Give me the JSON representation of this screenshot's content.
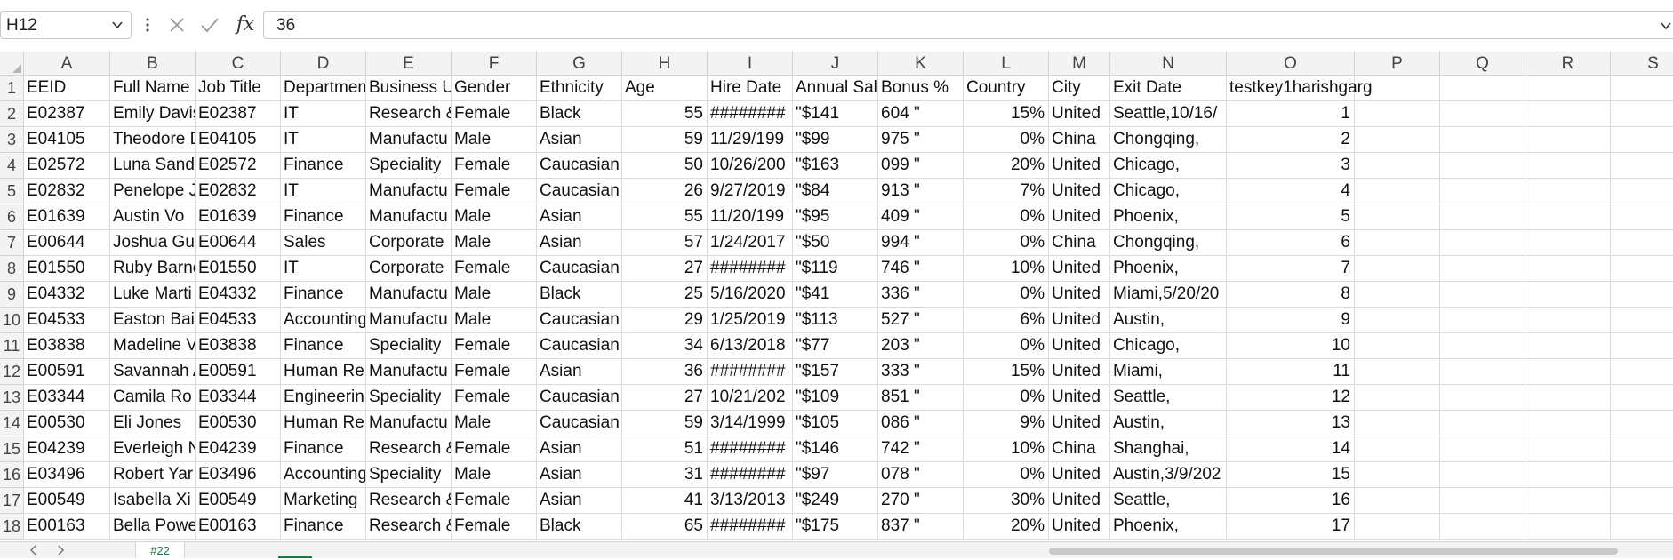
{
  "formula_bar": {
    "name_box": "H12",
    "cancel_icon": "x-icon",
    "enter_icon": "check-icon",
    "fx_label": "fx",
    "formula_value": "36"
  },
  "columns": [
    "A",
    "B",
    "C",
    "D",
    "E",
    "F",
    "G",
    "H",
    "I",
    "J",
    "K",
    "L",
    "M",
    "N",
    "O",
    "P",
    "Q",
    "R",
    "S"
  ],
  "rows": [
    {
      "n": "1",
      "cells": [
        "EEID",
        "Full Name",
        "Job Title",
        "Departmen",
        "Business U",
        "Gender",
        "Ethnicity",
        "Age",
        "Hire Date",
        "Annual Sal",
        "Bonus %",
        "Country",
        "City",
        "Exit Date",
        "testkey1harishgarg",
        "",
        "",
        "",
        ""
      ]
    },
    {
      "n": "2",
      "cells": [
        "E02387",
        "Emily Davis",
        "E02387",
        "IT",
        "Research &",
        "Female",
        "Black",
        "55",
        "########",
        "\"$141",
        "604 \"",
        "15%",
        "United",
        "Seattle,10/16/",
        "1",
        "",
        "",
        "",
        ""
      ]
    },
    {
      "n": "3",
      "cells": [
        "E04105",
        "Theodore D",
        "E04105",
        "IT",
        "Manufactu",
        "Male",
        "Asian",
        "59",
        "11/29/199",
        "\"$99",
        "975 \"",
        "0%",
        "China",
        "Chongqing,",
        "2",
        "",
        "",
        "",
        ""
      ]
    },
    {
      "n": "4",
      "cells": [
        "E02572",
        "Luna Sand",
        "E02572",
        "Finance",
        "Speciality",
        "Female",
        "Caucasian",
        "50",
        "10/26/200",
        "\"$163",
        "099 \"",
        "20%",
        "United",
        "Chicago,",
        "3",
        "",
        "",
        "",
        ""
      ]
    },
    {
      "n": "5",
      "cells": [
        "E02832",
        "Penelope J",
        "E02832",
        "IT",
        "Manufactu",
        "Female",
        "Caucasian",
        "26",
        "9/27/2019",
        "\"$84",
        "913 \"",
        "7%",
        "United",
        "Chicago,",
        "4",
        "",
        "",
        "",
        ""
      ]
    },
    {
      "n": "6",
      "cells": [
        "E01639",
        "Austin Vo",
        "E01639",
        "Finance",
        "Manufactu",
        "Male",
        "Asian",
        "55",
        "11/20/199",
        "\"$95",
        "409 \"",
        "0%",
        "United",
        "Phoenix,",
        "5",
        "",
        "",
        "",
        ""
      ]
    },
    {
      "n": "7",
      "cells": [
        "E00644",
        "Joshua Gu",
        "E00644",
        "Sales",
        "Corporate",
        "Male",
        "Asian",
        "57",
        "1/24/2017",
        "\"$50",
        "994 \"",
        "0%",
        "China",
        "Chongqing,",
        "6",
        "",
        "",
        "",
        ""
      ]
    },
    {
      "n": "8",
      "cells": [
        "E01550",
        "Ruby Barne",
        "E01550",
        "IT",
        "Corporate",
        "Female",
        "Caucasian",
        "27",
        "########",
        "\"$119",
        "746 \"",
        "10%",
        "United",
        "Phoenix,",
        "7",
        "",
        "",
        "",
        ""
      ]
    },
    {
      "n": "9",
      "cells": [
        "E04332",
        "Luke Marti",
        "E04332",
        "Finance",
        "Manufactu",
        "Male",
        "Black",
        "25",
        "5/16/2020",
        "\"$41",
        "336 \"",
        "0%",
        "United",
        "Miami,5/20/20",
        "8",
        "",
        "",
        "",
        ""
      ]
    },
    {
      "n": "10",
      "cells": [
        "E04533",
        "Easton Bai",
        "E04533",
        "Accounting",
        "Manufactu",
        "Male",
        "Caucasian",
        "29",
        "1/25/2019",
        "\"$113",
        "527 \"",
        "6%",
        "United",
        "Austin,",
        "9",
        "",
        "",
        "",
        ""
      ]
    },
    {
      "n": "11",
      "cells": [
        "E03838",
        "Madeline V",
        "E03838",
        "Finance",
        "Speciality",
        "Female",
        "Caucasian",
        "34",
        "6/13/2018",
        "\"$77",
        "203 \"",
        "0%",
        "United",
        "Chicago,",
        "10",
        "",
        "",
        "",
        ""
      ]
    },
    {
      "n": "12",
      "cells": [
        "E00591",
        "Savannah A",
        "E00591",
        "Human Re",
        "Manufactu",
        "Female",
        "Asian",
        "36",
        "########",
        "\"$157",
        "333 \"",
        "15%",
        "United",
        "Miami,",
        "11",
        "",
        "",
        "",
        ""
      ]
    },
    {
      "n": "13",
      "cells": [
        "E03344",
        "Camila Ro",
        "E03344",
        "Engineerin",
        "Speciality",
        "Female",
        "Caucasian",
        "27",
        "10/21/202",
        "\"$109",
        "851 \"",
        "0%",
        "United",
        "Seattle,",
        "12",
        "",
        "",
        "",
        ""
      ]
    },
    {
      "n": "14",
      "cells": [
        "E00530",
        "Eli Jones",
        "E00530",
        "Human Re",
        "Manufactu",
        "Male",
        "Caucasian",
        "59",
        "3/14/1999",
        "\"$105",
        "086 \"",
        "9%",
        "United",
        "Austin,",
        "13",
        "",
        "",
        "",
        ""
      ]
    },
    {
      "n": "15",
      "cells": [
        "E04239",
        "Everleigh N",
        "E04239",
        "Finance",
        "Research &",
        "Female",
        "Asian",
        "51",
        "########",
        "\"$146",
        "742 \"",
        "10%",
        "China",
        "Shanghai,",
        "14",
        "",
        "",
        "",
        ""
      ]
    },
    {
      "n": "16",
      "cells": [
        "E03496",
        "Robert Yar",
        "E03496",
        "Accounting",
        "Speciality",
        "Male",
        "Asian",
        "31",
        "########",
        "\"$97",
        "078 \"",
        "0%",
        "United",
        "Austin,3/9/202",
        "15",
        "",
        "",
        "",
        ""
      ]
    },
    {
      "n": "17",
      "cells": [
        "E00549",
        "Isabella Xi",
        "E00549",
        "Marketing",
        "Research &",
        "Female",
        "Asian",
        "41",
        "3/13/2013",
        "\"$249",
        "270 \"",
        "30%",
        "United",
        "Seattle,",
        "16",
        "",
        "",
        "",
        ""
      ]
    },
    {
      "n": "18",
      "cells": [
        "E00163",
        "Bella Powe",
        "E00163",
        "Finance",
        "Research &",
        "Female",
        "Black",
        "65",
        "########",
        "\"$175",
        "837 \"",
        "20%",
        "United",
        "Phoenix,",
        "17",
        "",
        "",
        "",
        ""
      ]
    }
  ],
  "sheet_tabs": [
    {
      "label": "#22"
    }
  ],
  "icons": {
    "prev": "chevron-left-icon",
    "next": "chevron-right-icon"
  }
}
